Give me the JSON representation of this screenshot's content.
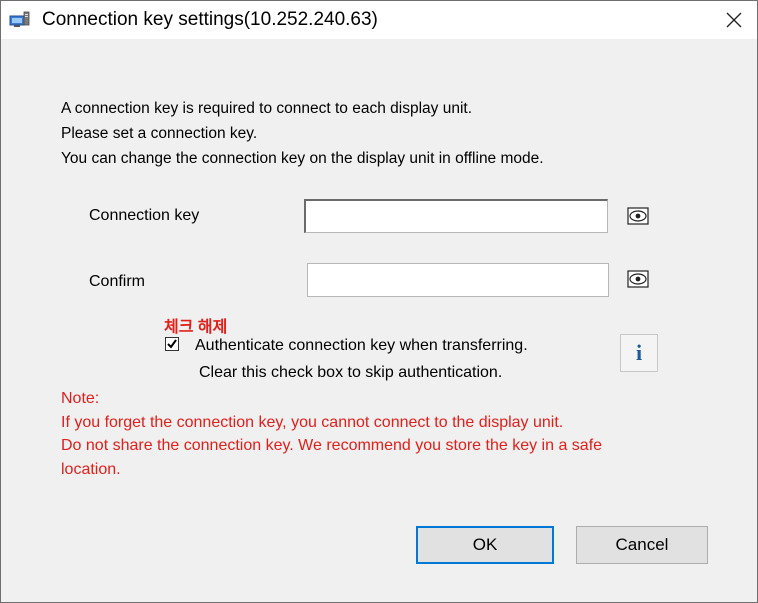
{
  "window": {
    "title": "Connection key settings(10.252.240.63)"
  },
  "message": {
    "line1": "A connection key is required to connect to each display unit.",
    "line2": "Please set a connection key.",
    "line3": "You can change the connection key on the display unit in offline mode."
  },
  "form": {
    "connection_key_label": "Connection key",
    "connection_key_value": "",
    "confirm_label": "Confirm",
    "confirm_value": ""
  },
  "annotation": {
    "korean_text": "체크 해제"
  },
  "authenticate": {
    "checked": true,
    "label": "Authenticate connection key when transferring.",
    "sublabel": "Clear this check box to skip authentication."
  },
  "info_button": {
    "label": "i"
  },
  "note": {
    "line1": "Note:",
    "line2": "If you forget the connection key, you cannot connect to the display unit.",
    "line3": "Do not share the connection key. We recommend you store the key in a safe",
    "line4": "location."
  },
  "buttons": {
    "ok_label": "OK",
    "cancel_label": "Cancel"
  },
  "colors": {
    "note_red": "#e0201b",
    "focus_blue": "#0078d7",
    "info_blue": "#1a5aa0"
  }
}
